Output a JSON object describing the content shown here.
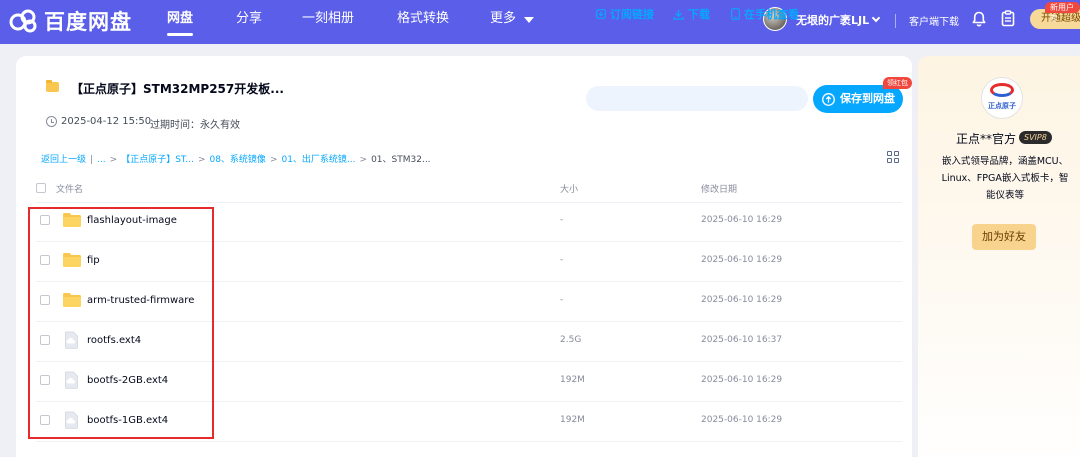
{
  "brand": {
    "name": "百度网盘"
  },
  "nav": {
    "items": [
      {
        "label": "网盘",
        "active": true
      },
      {
        "label": "分享"
      },
      {
        "label": "一刻相册"
      },
      {
        "label": "格式转换"
      },
      {
        "label": "更多"
      }
    ]
  },
  "user": {
    "name": "无垠的广袤LJL",
    "client_download": "客户端下载",
    "vip_button": "开通超级",
    "new_user_badge": "新用户专"
  },
  "share": {
    "title": "【正点原子】STM32MP257开发板...",
    "date": "2025-04-12 15:50",
    "expire": "过期时间：永久有效",
    "actions": {
      "subscribe": "订阅链接",
      "download": "下载",
      "view_on_phone": "在手机查看",
      "save": "保存到网盘",
      "redpack_badge": "领红包"
    }
  },
  "breadcrumb": {
    "back": "返回上一级",
    "items": [
      "...",
      "【正点原子】ST...",
      "08、系统镜像",
      "01、出厂系统镜...",
      "01、STM32..."
    ]
  },
  "table": {
    "headers": {
      "name": "文件名",
      "size": "大小",
      "date": "修改日期"
    },
    "rows": [
      {
        "type": "folder",
        "name": "flashlayout-image",
        "size": "-",
        "date": "2025-06-10 16:29"
      },
      {
        "type": "folder",
        "name": "fip",
        "size": "-",
        "date": "2025-06-10 16:29"
      },
      {
        "type": "folder",
        "name": "arm-trusted-firmware",
        "size": "-",
        "date": "2025-06-10 16:29"
      },
      {
        "type": "file",
        "name": "rootfs.ext4",
        "size": "2.5G",
        "date": "2025-06-10 16:37"
      },
      {
        "type": "file",
        "name": "bootfs-2GB.ext4",
        "size": "192M",
        "date": "2025-06-10 16:29"
      },
      {
        "type": "file",
        "name": "bootfs-1GB.ext4",
        "size": "192M",
        "date": "2025-06-10 16:29"
      }
    ]
  },
  "side": {
    "logo_text": "正点原子",
    "brand_name": "正点**官方",
    "svip": "SVIP8",
    "description": "嵌入式领导品牌，涵盖MCU、Linux、FPGA嵌入式板卡，智能仪表等",
    "add_friend": "加为好友"
  },
  "colors": {
    "nav_bg": "#5b5ee8",
    "accent": "#06a7ff",
    "highlight": "#e52b2b"
  }
}
